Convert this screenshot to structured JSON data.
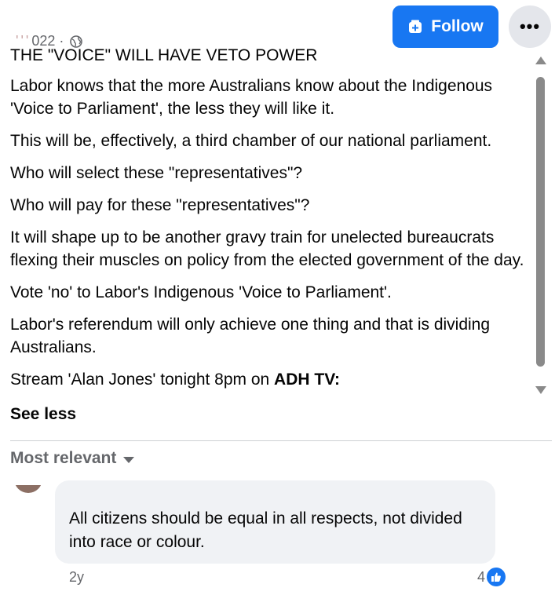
{
  "header": {
    "follow_label": "Follow",
    "more_label": "•••",
    "date_visible": "022 ·",
    "date_obscured": "' ' '"
  },
  "post": {
    "headline": "THE \"VOICE\" WILL HAVE VETO POWER",
    "paragraphs": [
      "Labor knows that the more Australians know about the Indigenous 'Voice to Parliament', the less they will like it.",
      "This will be, effectively, a third chamber of our national parliament.",
      "Who will select these \"representatives\"?",
      "Who will pay for these \"representatives\"?",
      "It will shape up to be another gravy train for unelected bureaucrats flexing their muscles on policy from the elected government of the day.",
      "Vote 'no' to Labor's Indigenous 'Voice to Parliament'.",
      "Labor's referendum will only achieve one thing and that is dividing Australians."
    ],
    "cut_off_line_prefix": "Stream 'Alan Jones' tonight 8pm on ",
    "cut_off_line_bold": "ADH TV:",
    "see_less_label": "See less"
  },
  "comments": {
    "sort_label": "Most relevant",
    "items": [
      {
        "text": "All citizens should be equal in all respects, not divided into race or colour.",
        "time": "2y",
        "reaction_count": "4"
      }
    ]
  },
  "colors": {
    "accent": "#1877f2",
    "secondary_text": "#65676b",
    "bubble_bg": "#f0f2f5"
  }
}
